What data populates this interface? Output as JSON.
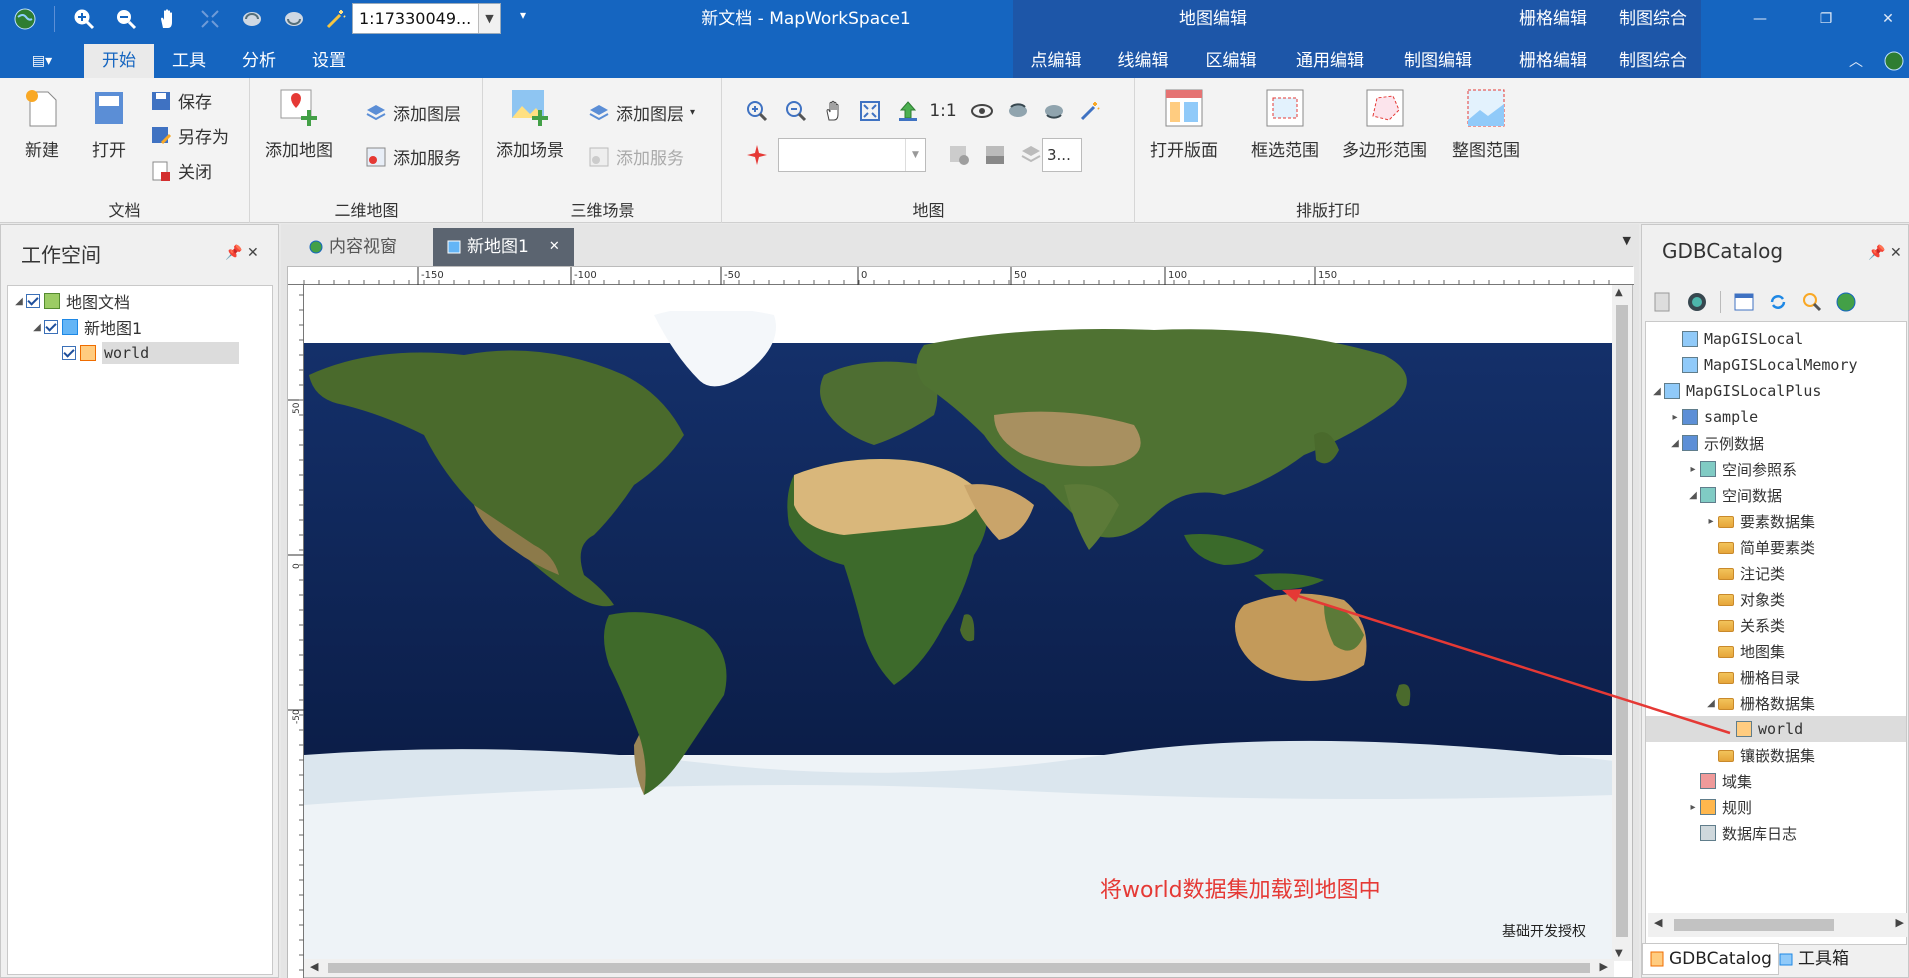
{
  "window": {
    "title": "新文档 - MapWorkSpace1",
    "scale_value": "1:17330049...",
    "controls": [
      "minimize-icon",
      "restore-icon",
      "close-icon"
    ]
  },
  "context_headers": {
    "map_edit": "地图编辑",
    "raster_edit": "栅格编辑",
    "cartography": "制图综合"
  },
  "context_tabs": [
    "点编辑",
    "线编辑",
    "区编辑",
    "通用编辑",
    "制图编辑",
    "栅格编辑",
    "制图综合"
  ],
  "main_tabs": [
    "开始",
    "工具",
    "分析",
    "设置"
  ],
  "ribbon": {
    "document": {
      "label": "文档",
      "new": "新建",
      "open": "打开",
      "save": "保存",
      "save_as": "另存为",
      "close": "关闭"
    },
    "map2d": {
      "label": "二维地图",
      "add_map": "添加地图",
      "add_layer": "添加图层",
      "add_service": "添加服务"
    },
    "scene3d": {
      "label": "三维场景",
      "add_scene": "添加场景",
      "add_layer": "添加图层",
      "add_service": "添加服务"
    },
    "map": {
      "label": "地图",
      "one_to_one": "1:1",
      "transparency": "3..."
    },
    "layout": {
      "label": "排版打印",
      "open_layout": "打开版面",
      "box_extent": "框选范围",
      "polygon_extent": "多边形范围",
      "full_extent": "整图范围"
    }
  },
  "workspace": {
    "title": "工作空间",
    "tree": [
      {
        "label": "地图文档"
      },
      {
        "label": "新地图1"
      },
      {
        "label": "world"
      }
    ]
  },
  "doc_tabs": {
    "content_view": "内容视窗",
    "map_tab": "新地图1"
  },
  "ruler": {
    "top": [
      "-150",
      "-100",
      "-50",
      "0",
      "50",
      "100",
      "150"
    ],
    "left": [
      "50",
      "0",
      "-50"
    ]
  },
  "map": {
    "license": "基础开发授权",
    "annotation": "将world数据集加载到地图中"
  },
  "gdb": {
    "title": "GDBCatalog",
    "tree": [
      {
        "label": "MapGISLocal"
      },
      {
        "label": "MapGISLocalMemory"
      },
      {
        "label": "MapGISLocalPlus"
      },
      {
        "label": "sample"
      },
      {
        "label": "示例数据"
      },
      {
        "label": "空间参照系"
      },
      {
        "label": "空间数据"
      },
      {
        "label": "要素数据集"
      },
      {
        "label": "简单要素类"
      },
      {
        "label": "注记类"
      },
      {
        "label": "对象类"
      },
      {
        "label": "关系类"
      },
      {
        "label": "地图集"
      },
      {
        "label": "栅格目录"
      },
      {
        "label": "栅格数据集"
      },
      {
        "label": "world"
      },
      {
        "label": "镶嵌数据集"
      },
      {
        "label": "域集"
      },
      {
        "label": "规则"
      },
      {
        "label": "数据库日志"
      }
    ],
    "bottom_tabs": [
      "GDBCatalog",
      "工具箱"
    ]
  },
  "colors": {
    "titlebar": "#1565c0",
    "context_band": "#1d56a8",
    "annotation": "#e53935",
    "ocean": "#0d2350"
  }
}
